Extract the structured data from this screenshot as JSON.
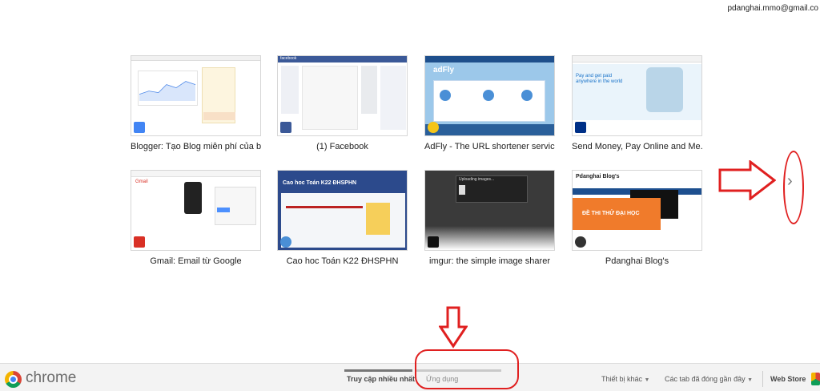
{
  "account": {
    "email": "pdanghai.mmo@gmail.co"
  },
  "tiles": [
    {
      "title": "Blogger: Tạo Blog miễn phí của b...",
      "favicon": "google-icon"
    },
    {
      "title": "(1) Facebook",
      "favicon": "facebook-icon"
    },
    {
      "title": "AdFly - The URL shortener servic...",
      "favicon": "adfly-icon"
    },
    {
      "title": "Send Money, Pay Online and Me...",
      "favicon": "paypal-icon"
    },
    {
      "title": "Gmail: Email từ Google",
      "favicon": "gmail-icon"
    },
    {
      "title": "Cao hoc Toán K22 ĐHSPHN",
      "favicon": "site-icon"
    },
    {
      "title": "imgur: the simple image sharer",
      "favicon": "imgur-icon"
    },
    {
      "title": "Pdanghai Blog's",
      "favicon": "blog-icon"
    }
  ],
  "thumb_text": {
    "facebook_small": "facebook",
    "adfly_logo": "adFly",
    "paypal_headline": "Pay and get paid anywhere in the world",
    "gmail_label": "Gmail",
    "caohoc_heading": "Cao hoc Toán K22 ĐHSPHN",
    "imgur_dialog": "Uploading images...",
    "blog_header": "Pdanghai Blog's",
    "blog_banner": "ĐỀ THI THỬ ĐẠI HỌC"
  },
  "footer": {
    "brand": "chrome",
    "tab_most_visited": "Truy cập nhiều nhất",
    "tab_apps": "Ứng dụng",
    "other_devices": "Thiết bị khác",
    "recently_closed": "Các tab đã đóng gần đây",
    "web_store": "Web Store"
  },
  "colors": {
    "annotation_red": "#e02020",
    "facebook_blue": "#3b5998",
    "adfly_blue": "#1e4f8c",
    "paypal_blue": "#003087",
    "gmail_red": "#d93025",
    "blog_orange": "#f07b2b"
  }
}
